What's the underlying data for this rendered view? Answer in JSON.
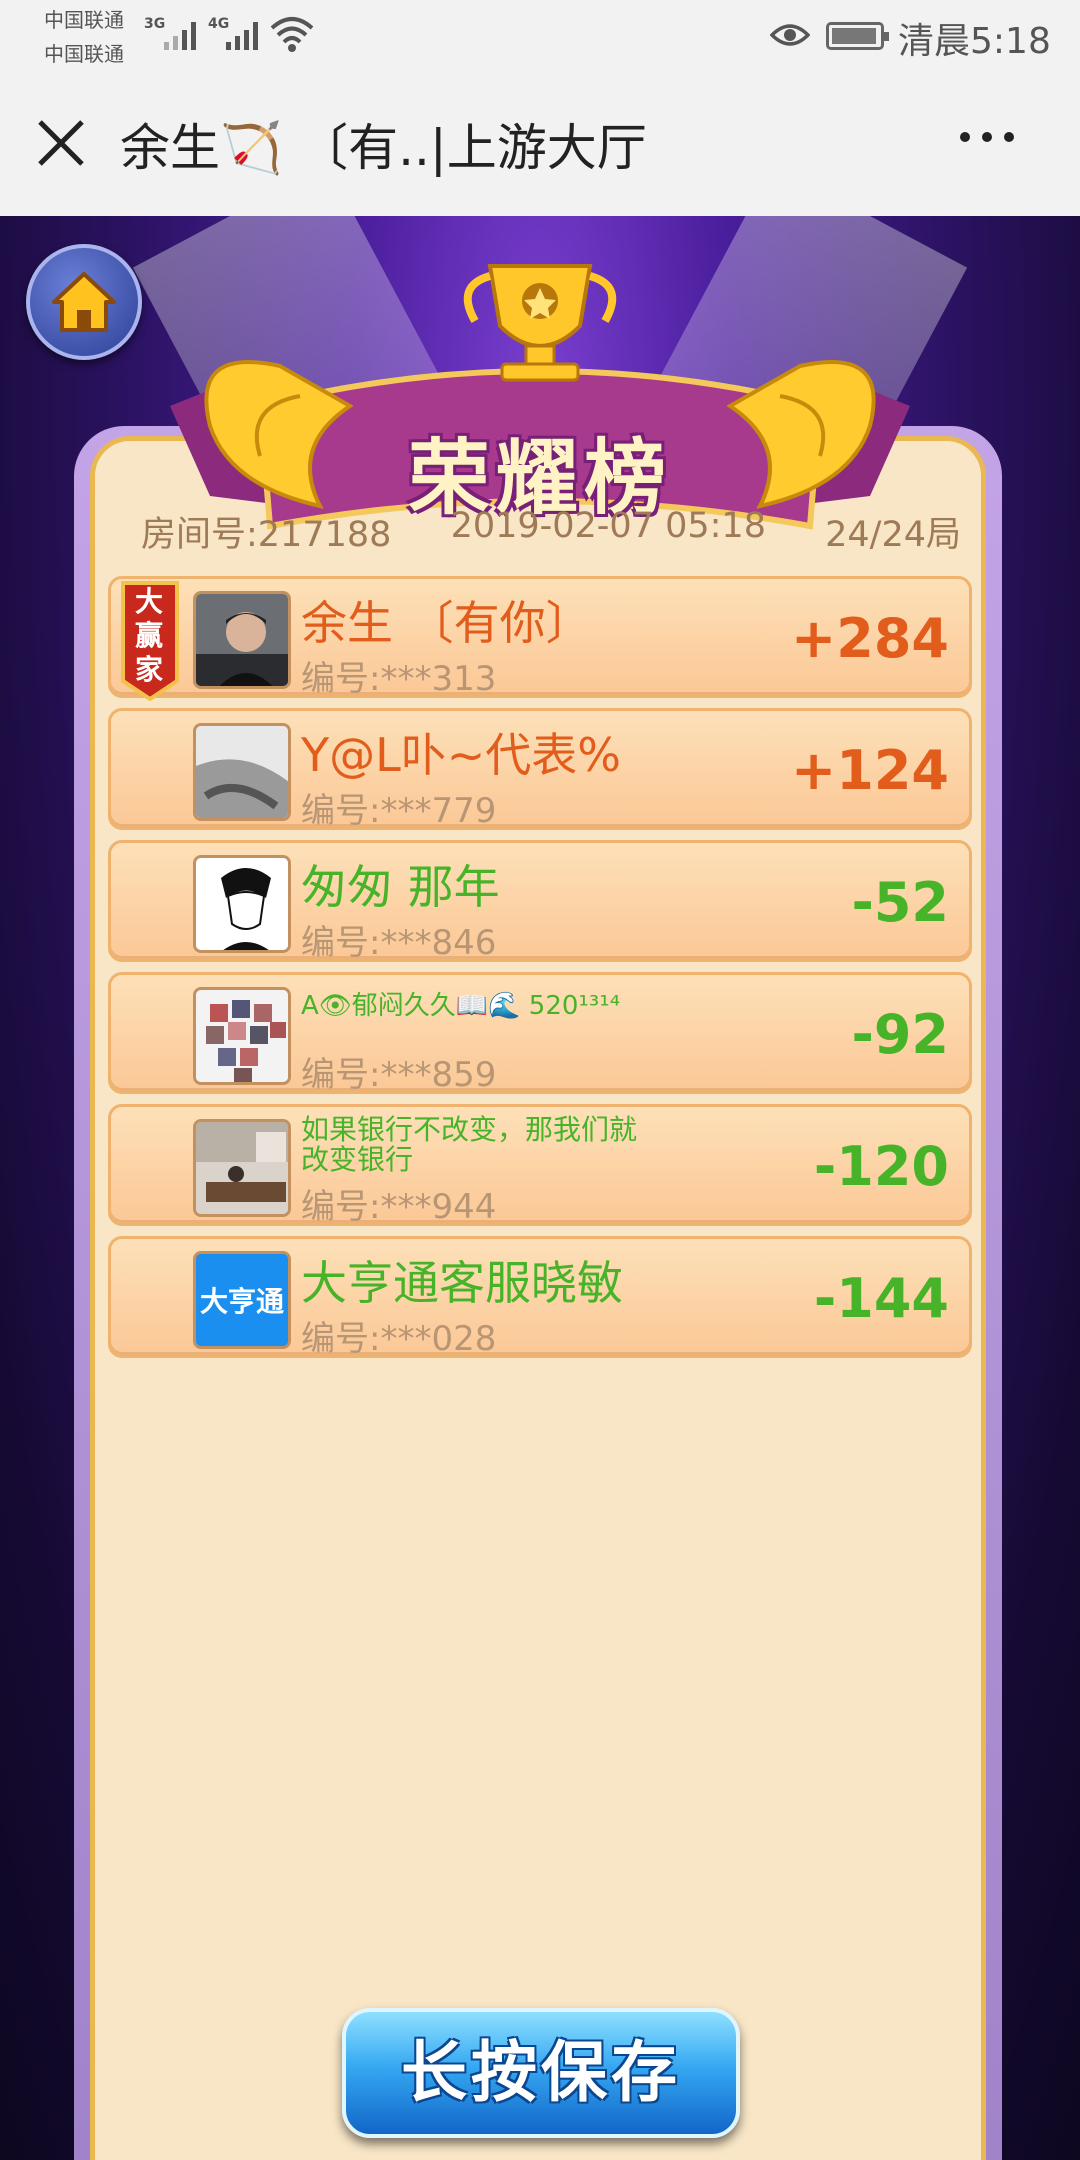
{
  "status_bar": {
    "carrier_1": "中国联通",
    "carrier_2": "中国联通",
    "network_1": "3G",
    "network_2": "4G",
    "time": "清晨5:18",
    "icons": [
      "signal-icon",
      "wifi-icon",
      "eye-icon",
      "battery-icon"
    ]
  },
  "title_bar": {
    "title": "余生🏹 〔有..|上游大厅",
    "close_icon": "close-icon",
    "more_icon": "more-icon"
  },
  "board": {
    "title": "荣耀榜",
    "room_label": "房间号:217188",
    "datetime": "2019-02-07 05:18",
    "rounds": "24/24局",
    "winner_badge": "大赢家"
  },
  "players": [
    {
      "name": "余生 〔有你〕",
      "id": "编号:***313",
      "score": "+284",
      "avatar": "photo"
    },
    {
      "name": "Y@L卟~代表%",
      "id": "编号:***779",
      "score": "+124",
      "avatar": "photo"
    },
    {
      "name": "匆匆 那年",
      "id": "编号:***846",
      "score": "-52",
      "avatar": "cartoon"
    },
    {
      "name": "A👁郁闷久久📖🌊 520¹³¹⁴",
      "id": "编号:***859",
      "score": "-92",
      "avatar": "collage"
    },
    {
      "name": "如果银行不改变，那我们就改变银行",
      "id": "编号:***944",
      "score": "-120",
      "avatar": "photo"
    },
    {
      "name": "大亨通客服晓敏",
      "id": "编号:***028",
      "score": "-144",
      "avatar": "logo",
      "avatar_text": "大亨通"
    }
  ],
  "save_button": "长按保存",
  "colors": {
    "positive": "#e25c1c",
    "negative": "#47b328",
    "panel": "#f8e6c6"
  }
}
